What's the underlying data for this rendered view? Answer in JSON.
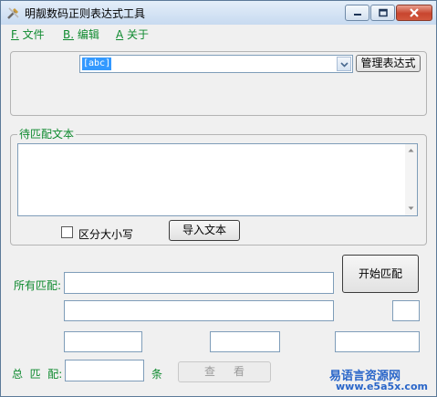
{
  "window": {
    "title": "明靓数码正则表达式工具",
    "controls": {
      "minimize_icon": "minimize-icon",
      "maximize_icon": "maximize-icon",
      "close_icon": "close-icon"
    }
  },
  "menu": [
    {
      "key": "F.",
      "label": "文件"
    },
    {
      "key": "B.",
      "label": "编辑"
    },
    {
      "key": "A",
      "label": "关于"
    }
  ],
  "regex": {
    "selected": "[abc]",
    "manage_button": "管理表达式"
  },
  "text_group": {
    "legend": "待匹配文本",
    "content": "",
    "case_sensitive_label": "区分大小写",
    "case_sensitive_checked": false,
    "import_button": "导入文本"
  },
  "results": {
    "all_matches_label": "所有匹配:",
    "start_button": "开始匹配",
    "total_label": "总  匹  配:",
    "unit_label": "条",
    "view_button": "查看"
  },
  "watermark": {
    "line1": "易语言资源网",
    "line2": "www.e5a5x.com"
  },
  "colors": {
    "accent_green": "#0f8a2f",
    "selection_blue": "#3399ff",
    "watermark_blue": "#2a66c9"
  }
}
